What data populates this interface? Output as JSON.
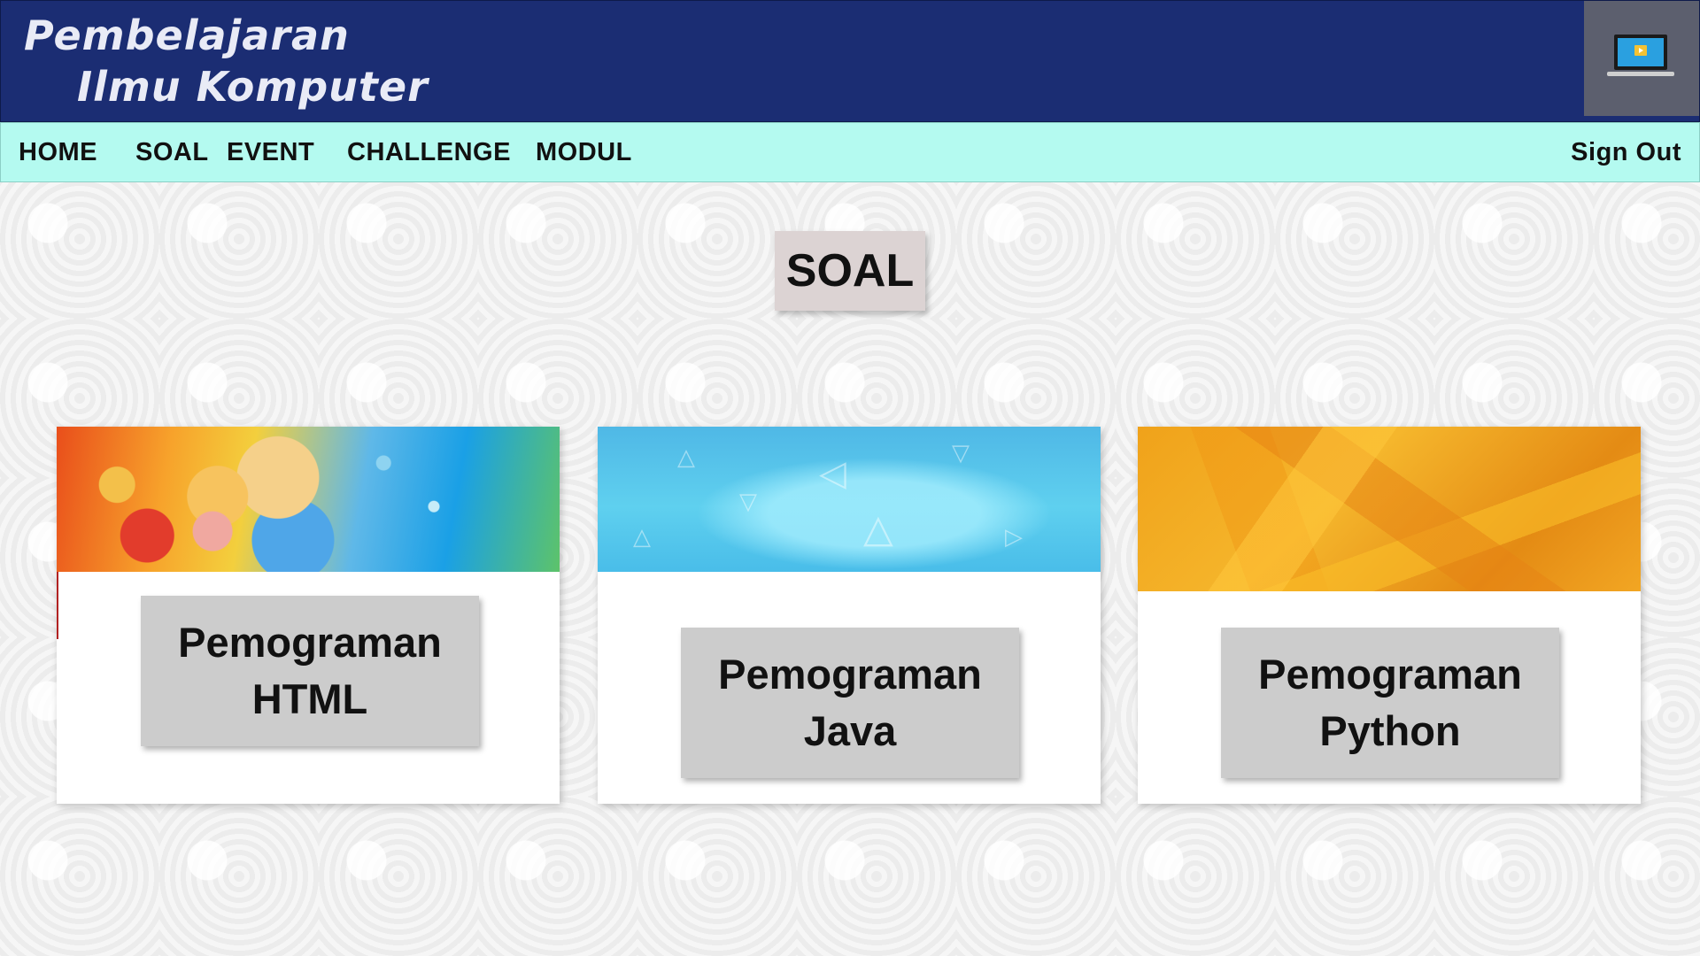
{
  "header": {
    "title_line1": "Pembelajaran",
    "title_line2": "Ilmu Komputer",
    "device_icon": "laptop-icon"
  },
  "nav": {
    "items": [
      {
        "label": "HOME"
      },
      {
        "label": "SOAL"
      },
      {
        "label": "EVENT"
      },
      {
        "label": "CHALLENGE"
      },
      {
        "label": "MODUL"
      }
    ],
    "sign_out": "Sign Out"
  },
  "page": {
    "title": "SOAL"
  },
  "cards": [
    {
      "label": "Pemograman\nHTML"
    },
    {
      "label": "Pemograman\nJava"
    },
    {
      "label": "Pemograman\nPython"
    }
  ],
  "colors": {
    "header_bg": "#1b2d73",
    "nav_bg": "#b4faf0",
    "title_bg": "#dcd3d3",
    "button_bg": "#cccccc"
  }
}
